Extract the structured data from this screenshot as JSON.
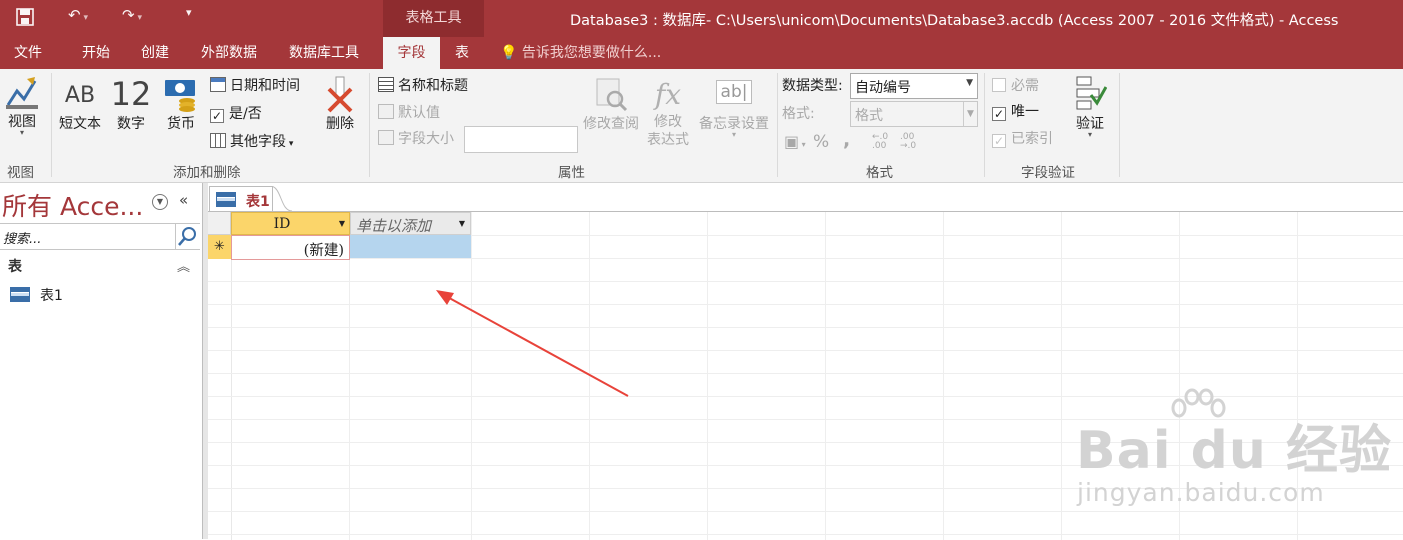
{
  "window": {
    "title": "Database3 : 数据库- C:\\Users\\unicom\\Documents\\Database3.accdb (Access 2007 - 2016 文件格式) - Access",
    "context_tools": "表格工具"
  },
  "ribbon_tabs": [
    "文件",
    "开始",
    "创建",
    "外部数据",
    "数据库工具",
    "字段",
    "表"
  ],
  "active_tab": "字段",
  "tell_me": "告诉我您想要做什么...",
  "groups": {
    "view": {
      "label": "视图",
      "button": "视图"
    },
    "add_delete": {
      "label": "添加和删除",
      "short_text": "短文本",
      "short_text_icon": "AB",
      "number": "数字",
      "number_icon": "12",
      "currency": "货币",
      "date_time": "日期和时间",
      "yes_no": "是/否",
      "more_fields": "其他字段",
      "delete": "删除"
    },
    "properties": {
      "label": "属性",
      "name_caption": "名称和标题",
      "default_value": "默认值",
      "field_size": "字段大小",
      "modify_lookups": "修改查阅",
      "modify_expression_1": "修改",
      "modify_expression_2": "表达式",
      "memo_settings": "备忘录设置",
      "memo_icon": "ab|"
    },
    "formatting": {
      "label": "格式",
      "data_type_label": "数据类型:",
      "data_type_value": "自动编号",
      "format_label": "格式:",
      "format_placeholder": "格式",
      "percent": "%",
      "comma": ","
    },
    "validation": {
      "label": "字段验证",
      "required": "必需",
      "unique": "唯一",
      "indexed": "已索引",
      "validation_button": "验证",
      "unique_checked": true
    }
  },
  "nav_pane": {
    "title": "所有 Acce...",
    "search_placeholder": "搜索...",
    "section": "表",
    "items": [
      "表1"
    ]
  },
  "document": {
    "tab": "表1",
    "columns": [
      "ID",
      "单击以添加"
    ],
    "new_row": [
      "(新建)",
      ""
    ],
    "new_row_marker": "✳"
  },
  "watermark": {
    "brand": "Bai  du 经验",
    "url": "jingyan.baidu.com"
  },
  "colors": {
    "accent": "#a4373a",
    "header_selected": "#fbd56a",
    "cell_selected": "#b5d5ee"
  }
}
